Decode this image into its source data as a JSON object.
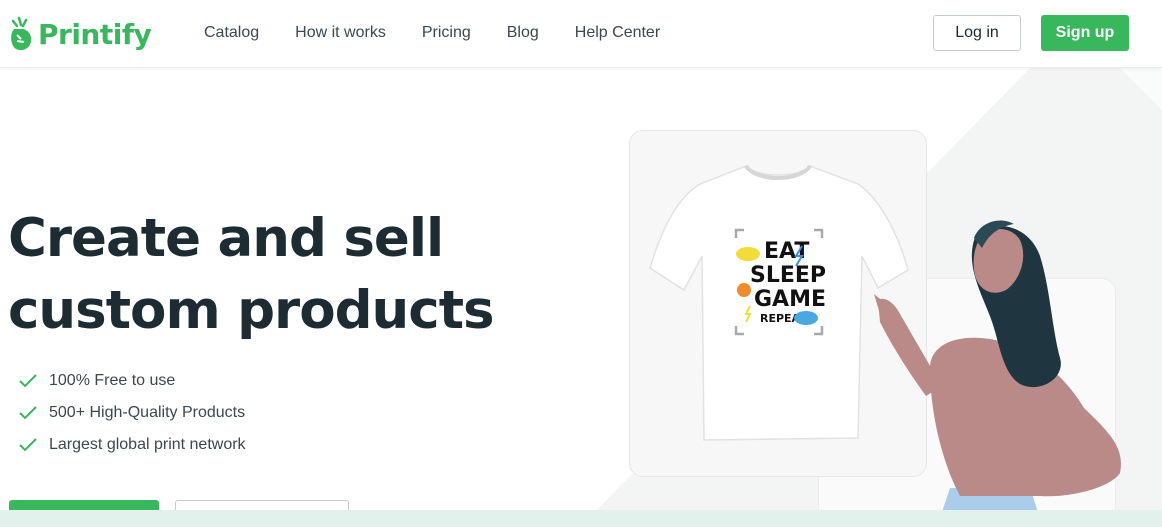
{
  "header": {
    "logo_text": "Printify",
    "nav": [
      "Catalog",
      "How it works",
      "Pricing",
      "Blog",
      "Help Center"
    ],
    "login_label": "Log in",
    "signup_label": "Sign up"
  },
  "hero": {
    "headline_line1": "Create and sell",
    "headline_line2": "custom products",
    "features": [
      "100% Free to use",
      "500+ High-Quality Products",
      "Largest global print network"
    ]
  },
  "product": {
    "design_lines": [
      "EAT",
      "SLEEP",
      "GAME",
      "REPEAT"
    ]
  },
  "colors": {
    "brand_green": "#39b75d",
    "text_dark": "#1d2b33",
    "strip": "#e3f1ec"
  }
}
